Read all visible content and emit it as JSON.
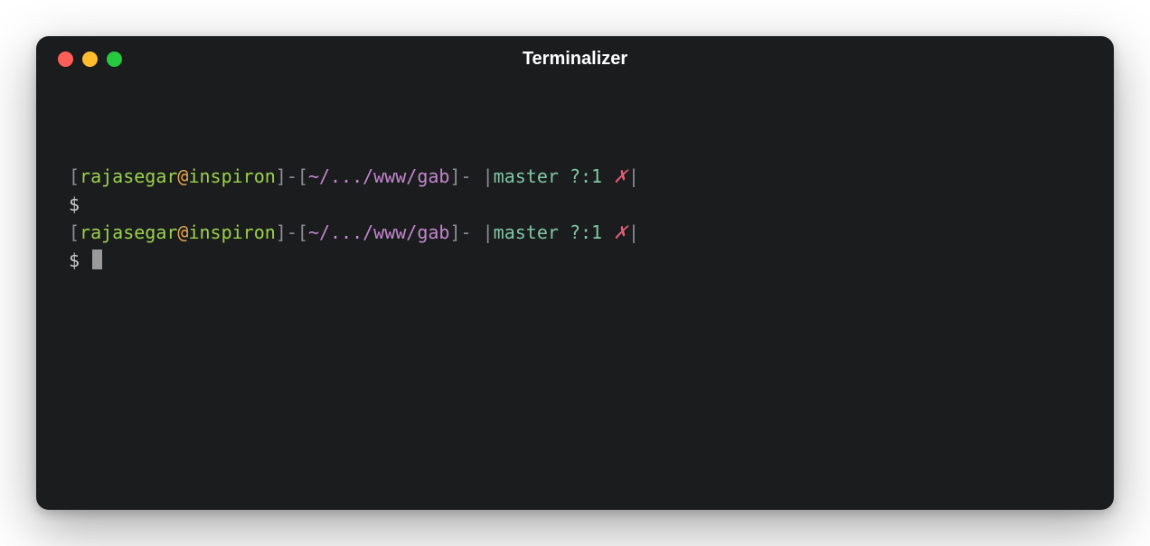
{
  "window": {
    "title": "Terminalizer"
  },
  "prompts": [
    {
      "open_bracket": "[",
      "user": "rajasegar",
      "at": "@",
      "host": "inspiron",
      "close_bracket": "]",
      "sep1": "-",
      "open_bracket2": "[",
      "path": "~/.../www/gab",
      "close_bracket2": "]",
      "sep2": "-",
      "pipe_open": " |",
      "branch": "master ",
      "status": "?:1 ",
      "xmark": "✗",
      "pipe_close": "|",
      "dollar": "$",
      "command": ""
    },
    {
      "open_bracket": "[",
      "user": "rajasegar",
      "at": "@",
      "host": "inspiron",
      "close_bracket": "]",
      "sep1": "-",
      "open_bracket2": "[",
      "path": "~/.../www/gab",
      "close_bracket2": "]",
      "sep2": "-",
      "pipe_open": " |",
      "branch": "master ",
      "status": "?:1 ",
      "xmark": "✗",
      "pipe_close": "|",
      "dollar": "$ ",
      "command": ""
    }
  ]
}
